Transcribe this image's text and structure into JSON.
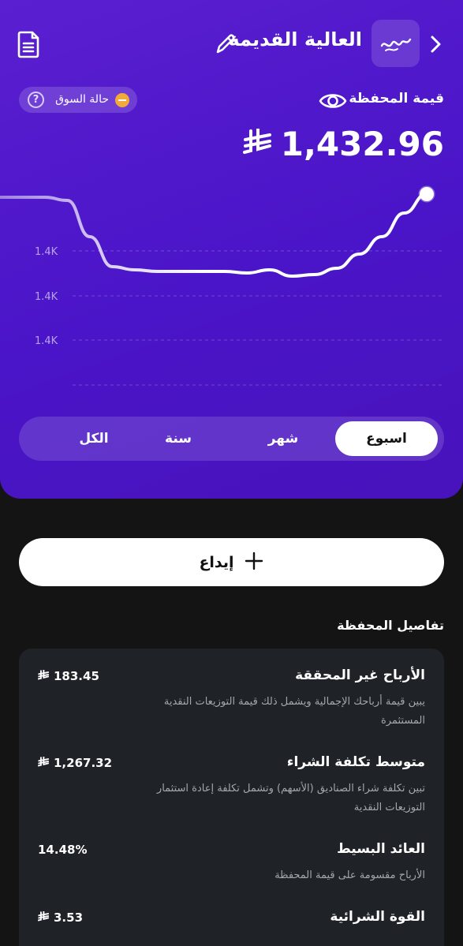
{
  "header": {
    "portfolio_name": "العالية القديمة",
    "icons": [
      "document-icon",
      "pencil-icon",
      "portfolio-logo-icon",
      "chevron-right-icon"
    ]
  },
  "market_status": {
    "label": "حالة السوق",
    "status_color": "#f2a93b"
  },
  "portfolio_value": {
    "label": "قيمة المحفظة",
    "amount": "1,432.96",
    "currency_icon": "riyal-symbol-icon"
  },
  "chart_data": {
    "type": "line",
    "y_tick_labels": [
      "1.4K",
      "1.4K",
      "1.4K"
    ],
    "grid": "dashed horizontal",
    "line_color": "#ffffff",
    "series": [
      {
        "values": [
          1433.3,
          1433.3,
          1433.3,
          1433.28,
          1433.05,
          1432.86,
          1432.84,
          1432.83,
          1432.83,
          1432.83,
          1432.83,
          1432.82,
          1432.84,
          1432.8,
          1432.81,
          1432.85,
          1432.94,
          1433.05,
          1433.2,
          1433.32
        ]
      }
    ]
  },
  "range_tabs": {
    "items": [
      "اسبوع",
      "شهر",
      "سنة",
      "الكل"
    ],
    "selected": "اسبوع"
  },
  "deposit": {
    "label": "إيداع"
  },
  "details": {
    "title": "تفاصيل المحفظة",
    "rows": [
      {
        "title": "الأرباح غير المحققة",
        "value": "183.45",
        "currency": true,
        "desc": "يبين قيمة أرباحك الإجمالية ويشمل ذلك قيمة التوزيعات النقدية المستثمرة"
      },
      {
        "title": "متوسط تكلفة الشراء",
        "value": "1,267.32",
        "currency": true,
        "desc": "تبين تكلفة شراء الصناديق (الأسهم) وتشمل تكلفة إعادة استثمار التوزيعات النقدية"
      },
      {
        "title": "العائد البسيط",
        "value": "14.48%",
        "currency": false,
        "desc": "الأرباح مقسومة على قيمة المحفظة"
      },
      {
        "title": "القوة الشرائية",
        "value": "3.53",
        "currency": true,
        "desc": ""
      }
    ]
  }
}
